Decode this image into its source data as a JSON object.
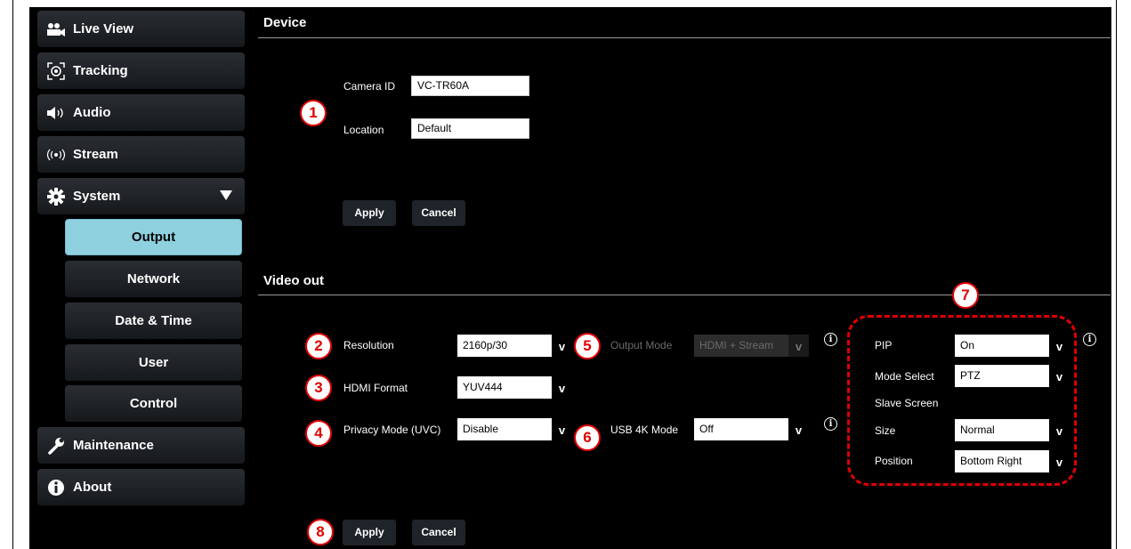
{
  "sidebar": {
    "items": [
      {
        "label": "Live View",
        "icon": "camera-icon"
      },
      {
        "label": "Tracking",
        "icon": "tracking-icon"
      },
      {
        "label": "Audio",
        "icon": "speaker-icon"
      },
      {
        "label": "Stream",
        "icon": "stream-icon"
      },
      {
        "label": "System",
        "icon": "gear-icon"
      },
      {
        "label": "Maintenance",
        "icon": "wrench-icon"
      },
      {
        "label": "About",
        "icon": "info-icon"
      }
    ],
    "system_sub": [
      "Output",
      "Network",
      "Date & Time",
      "User",
      "Control"
    ],
    "active_sub": "Output"
  },
  "device": {
    "title": "Device",
    "camera_id_label": "Camera ID",
    "camera_id_value": "VC-TR60A",
    "location_label": "Location",
    "location_value": "Default",
    "apply_label": "Apply",
    "cancel_label": "Cancel"
  },
  "video_out": {
    "title": "Video out",
    "resolution_label": "Resolution",
    "resolution_value": "2160p/30",
    "hdmi_format_label": "HDMI Format",
    "hdmi_format_value": "YUV444",
    "privacy_label": "Privacy Mode (UVC)",
    "privacy_value": "Disable",
    "output_mode_label": "Output Mode",
    "output_mode_value": "HDMI + Stream",
    "usb4k_label": "USB 4K Mode",
    "usb4k_value": "Off",
    "pip_label": "PIP",
    "pip_value": "On",
    "mode_select_label": "Mode Select",
    "mode_select_value": "PTZ",
    "slave_screen_label": "Slave Screen",
    "size_label": "Size",
    "size_value": "Normal",
    "position_label": "Position",
    "position_value": "Bottom Right",
    "apply_label": "Apply",
    "cancel_label": "Cancel"
  },
  "markers": [
    "1",
    "2",
    "3",
    "4",
    "5",
    "6",
    "7",
    "8"
  ],
  "arrow_glyph": "v",
  "info_glyph": "i",
  "colors": {
    "accent_active": "#8fd0df",
    "marker_red": "#e00000",
    "background": "#000000"
  }
}
